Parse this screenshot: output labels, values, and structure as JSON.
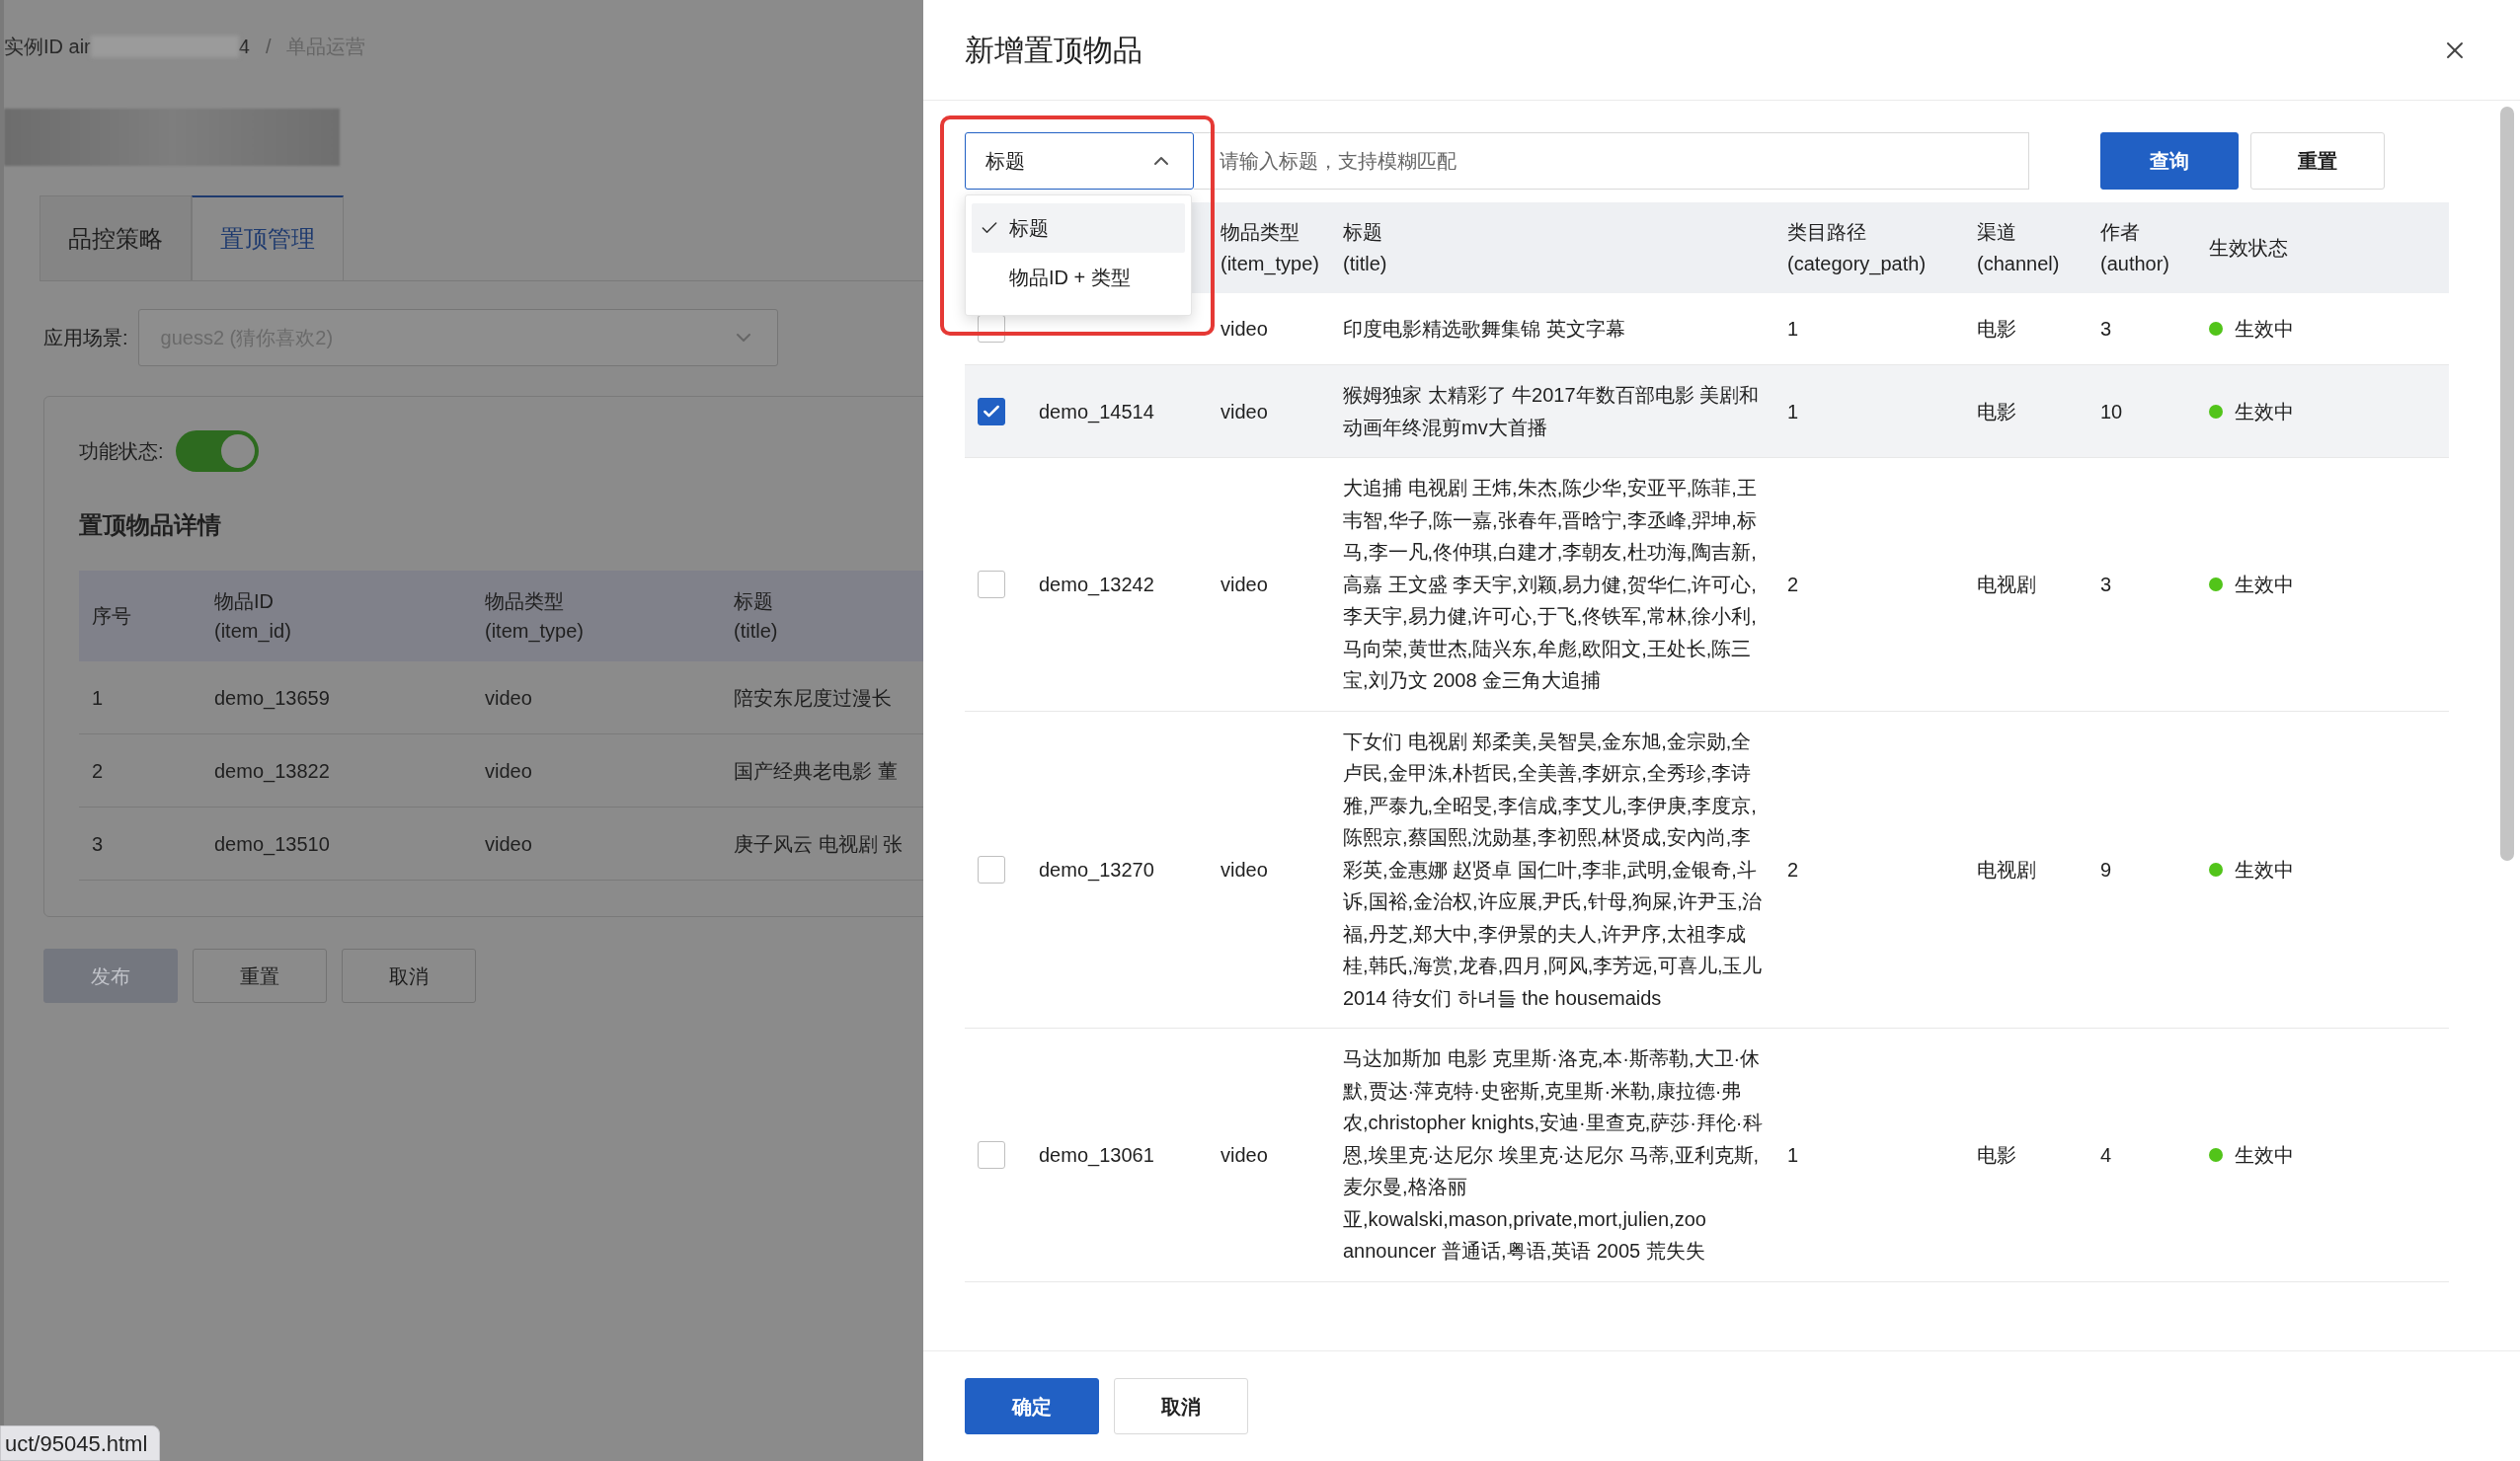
{
  "background_page": {
    "breadcrumb": {
      "instance_prefix": "实例ID air",
      "instance_suffix": "4",
      "separator": "/",
      "current": "单品运营"
    },
    "tabs": [
      {
        "label": "品控策略",
        "selected": false
      },
      {
        "label": "置顶管理",
        "selected": true
      }
    ],
    "scene": {
      "label": "应用场景:",
      "value": "guess2 (猜你喜欢2)",
      "disabled": true
    },
    "feature_status": {
      "label": "功能状态:",
      "on": true
    },
    "section_title": "置顶物品详情",
    "table": {
      "columns": [
        {
          "label": "序号"
        },
        {
          "label": "物品ID",
          "key": "(item_id)"
        },
        {
          "label": "物品类型",
          "key": "(item_type)"
        },
        {
          "label": "标题",
          "key": "(title)"
        }
      ],
      "rows": [
        {
          "index": "1",
          "item_id": "demo_13659",
          "item_type": "video",
          "title": "陪安东尼度过漫长"
        },
        {
          "index": "2",
          "item_id": "demo_13822",
          "item_type": "video",
          "title": "国产经典老电影 董"
        },
        {
          "index": "3",
          "item_id": "demo_13510",
          "item_type": "video",
          "title": "庚子风云 电视剧 张"
        }
      ]
    },
    "buttons": [
      {
        "label": "发布",
        "kind": "primary",
        "disabled": true
      },
      {
        "label": "重置",
        "kind": "default",
        "disabled": false
      },
      {
        "label": "取消",
        "kind": "default",
        "disabled": false
      }
    ]
  },
  "status_url": "uct/95045.html",
  "drawer": {
    "title": "新增置顶物品",
    "search": {
      "field_select": {
        "value": "标题",
        "expanded": true,
        "options": [
          {
            "label": "标题",
            "selected": true
          },
          {
            "label": "物品ID + 类型",
            "selected": false
          }
        ]
      },
      "placeholder": "请输入标题，支持模糊匹配",
      "buttons": [
        {
          "label": "查询",
          "kind": "primary"
        },
        {
          "label": "重置",
          "kind": "default"
        }
      ]
    },
    "table": {
      "columns": [
        {
          "label": "物品类型",
          "key": "(item_type)"
        },
        {
          "label": "标题",
          "key": "(title)"
        },
        {
          "label": "类目路径",
          "key": "(category_path)"
        },
        {
          "label": "渠道",
          "key": "(channel)"
        },
        {
          "label": "作者",
          "key": "(author)"
        },
        {
          "label": "生效状态"
        }
      ],
      "rows": [
        {
          "checked": false,
          "item_type": "video",
          "title": "印度电影精选歌舞集锦 英文字幕",
          "category_path": "1",
          "channel": "电影",
          "author": "3",
          "status": "生效中",
          "color": "#52c41a"
        },
        {
          "checked": true,
          "item_id": "demo_14514",
          "item_type": "video",
          "title": "猴姆独家 太精彩了 牛2017年数百部电影 美剧和动画年终混剪mv大首播",
          "category_path": "1",
          "channel": "电影",
          "author": "10",
          "status": "生效中",
          "color": "#52c41a"
        },
        {
          "checked": false,
          "item_id": "demo_13242",
          "item_type": "video",
          "title": "大追捕 电视剧 王炜,朱杰,陈少华,安亚平,陈菲,王韦智,华子,陈一嘉,张春年,晋晗宁,李丞峰,羿坤,标马,李一凡,佟仲琪,白建才,李朝友,杜功海,陶吉新,高嘉 王文盛 李天宇,刘颖,易力健,贺华仁,许可心,李天宇,易力健,许可心,于飞,佟铁军,常林,徐小利,马向荣,黄世杰,陆兴东,牟彪,欧阳文,王处长,陈三宝,刘乃文 2008 金三角大追捕",
          "category_path": "2",
          "channel": "电视剧",
          "author": "3",
          "status": "生效中",
          "color": "#52c41a"
        },
        {
          "checked": false,
          "item_id": "demo_13270",
          "item_type": "video",
          "title": "下女们 电视剧 郑柔美,吴智昊,金东旭,金宗勋,全卢民,金甲洙,朴哲民,全美善,李妍京,全秀珍,李诗雅,严泰九,全昭旻,李信成,李艾儿,李伊庚,李度京,陈熙京,蔡国熙,沈勋基,李初熙,林贤成,安內尚,李彩英,金惠娜 赵贤卓 国仁叶,李非,武明,金银奇,斗诉,国裕,金治权,许应展,尹氏,针母,狗屎,许尹玉,治福,丹芝,郑大中,李伊景的夫人,许尹序,太祖李成桂,韩氏,海赏,龙春,四月,阿风,李芳远,可喜儿,玉儿 2014 待女们 하녀들 the housemaids",
          "category_path": "2",
          "channel": "电视剧",
          "author": "9",
          "status": "生效中",
          "color": "#52c41a"
        },
        {
          "checked": false,
          "item_id": "demo_13061",
          "item_type": "video",
          "title": "马达加斯加 电影 克里斯·洛克,本·斯蒂勒,大卫·休默,贾达·萍克特·史密斯,克里斯·米勒,康拉德·弗农,christopher knights,安迪·里查克,萨莎·拜伦·科恩,埃里克·达尼尔 埃里克·达尼尔 马蒂,亚利克斯,麦尔曼,格洛丽亚,kowalski,mason,private,mort,julien,zoo announcer 普通话,粤语,英语 2005 荒失失",
          "category_path": "1",
          "channel": "电影",
          "author": "4",
          "status": "生效中",
          "color": "#52c41a"
        }
      ]
    },
    "footer_buttons": [
      {
        "label": "确定",
        "kind": "primary"
      },
      {
        "label": "取消",
        "kind": "default"
      }
    ]
  }
}
